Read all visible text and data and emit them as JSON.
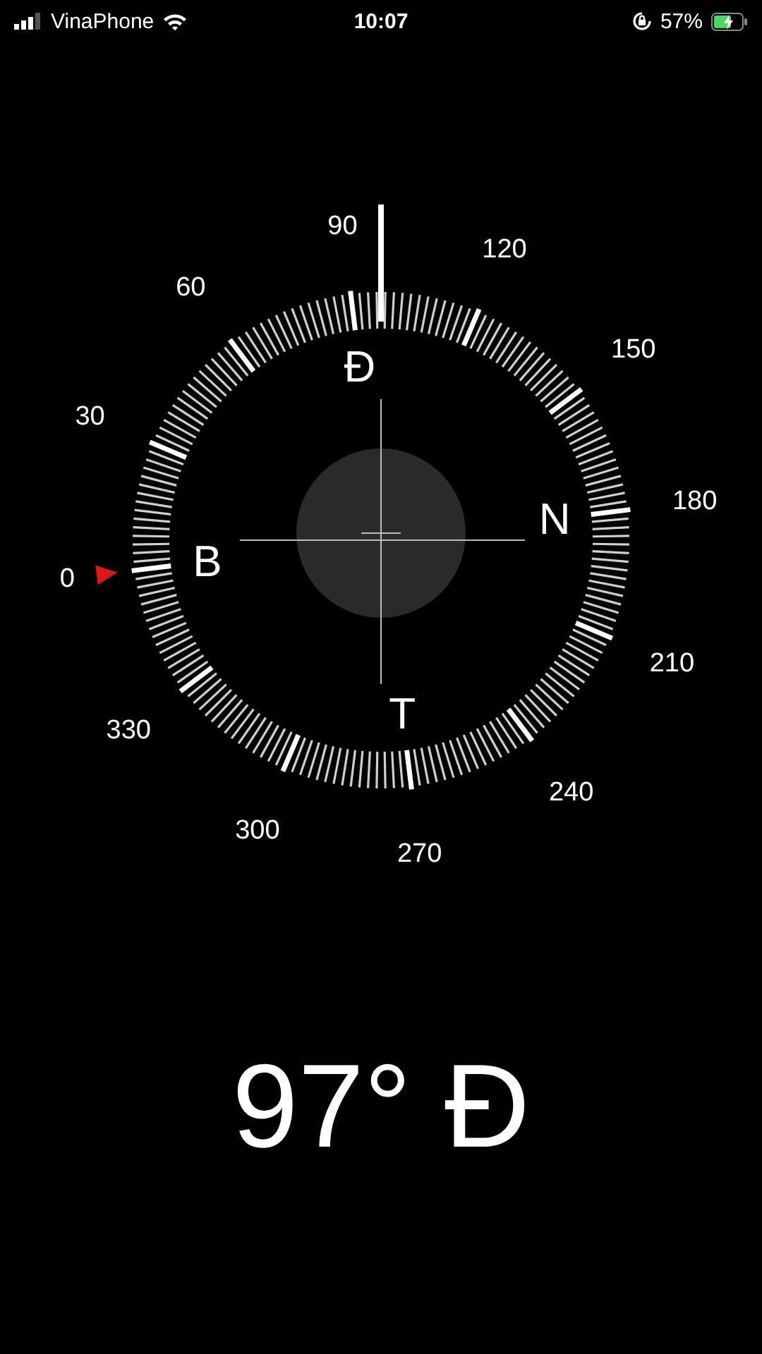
{
  "status_bar": {
    "carrier": "VinaPhone",
    "time": "10:07",
    "battery": "57%"
  },
  "dial": {
    "degree_labels": [
      "0",
      "30",
      "60",
      "90",
      "120",
      "150",
      "180",
      "210",
      "240",
      "270",
      "300",
      "330"
    ],
    "cardinals": [
      "B",
      "Đ",
      "N",
      "T"
    ]
  },
  "heading": "97° Đ"
}
